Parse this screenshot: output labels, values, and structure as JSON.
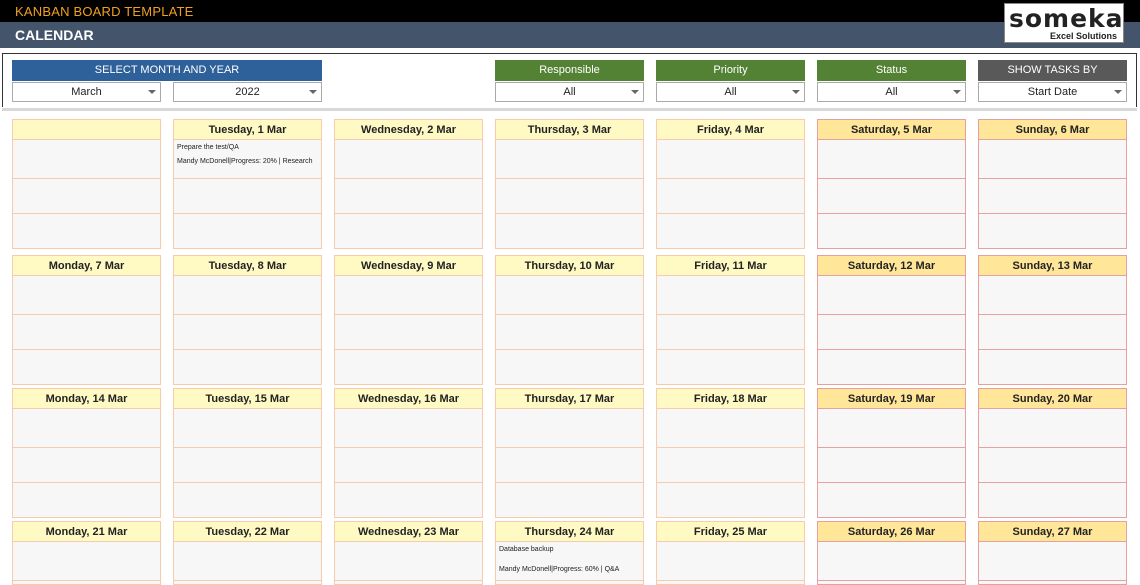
{
  "header": {
    "app_title": "KANBAN BOARD TEMPLATE",
    "page_title": "CALENDAR",
    "logo_brand": "someka",
    "logo_tagline": "Excel Solutions"
  },
  "filters": {
    "month_year_label": "SELECT MONTH AND YEAR",
    "month_value": "March",
    "year_value": "2022",
    "responsible_label": "Responsible",
    "responsible_value": "All",
    "priority_label": "Priority",
    "priority_value": "All",
    "status_label": "Status",
    "status_value": "All",
    "show_tasks_label": "SHOW TASKS BY",
    "show_tasks_value": "Start Date"
  },
  "colors": {
    "month_header": "#2e6099",
    "green_header": "#548235",
    "gray_header": "#595959",
    "weekday_head": "#fff9c4",
    "weekend_head": "#ffe699",
    "weekday_border": "#f8cbad",
    "weekend_border": "#e6a0a0"
  },
  "weeks": [
    [
      "",
      "Tuesday, 1 Mar",
      "Wednesday, 2 Mar",
      "Thursday, 3 Mar",
      "Friday, 4 Mar",
      "Saturday, 5 Mar",
      "Sunday, 6 Mar"
    ],
    [
      "Monday, 7 Mar",
      "Tuesday, 8 Mar",
      "Wednesday, 9 Mar",
      "Thursday, 10 Mar",
      "Friday, 11 Mar",
      "Saturday, 12 Mar",
      "Sunday, 13 Mar"
    ],
    [
      "Monday, 14 Mar",
      "Tuesday, 15 Mar",
      "Wednesday, 16 Mar",
      "Thursday, 17 Mar",
      "Friday, 18 Mar",
      "Saturday, 19 Mar",
      "Sunday, 20 Mar"
    ],
    [
      "Monday, 21 Mar",
      "Tuesday, 22 Mar",
      "Wednesday, 23 Mar",
      "Thursday, 24 Mar",
      "Friday, 25 Mar",
      "Saturday, 26 Mar",
      "Sunday, 27 Mar"
    ]
  ],
  "tasks": [
    {
      "week": 0,
      "day": 1,
      "name": "Prepare the test/QA",
      "detail": "Mandy McDonell|Progress: 20% | Research"
    },
    {
      "week": 3,
      "day": 3,
      "name": "Database backup",
      "detail": "Mandy McDonell|Progress: 60% | Q&A"
    }
  ]
}
